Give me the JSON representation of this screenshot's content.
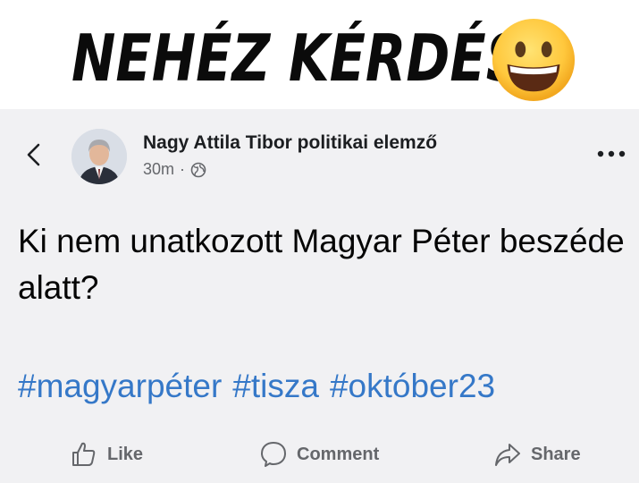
{
  "headline": {
    "title": "NEHÉZ KÉRDÉS",
    "emoji_icon": "grinning-face-emoji"
  },
  "post": {
    "author": "Nagy Attila Tibor politikai elemző",
    "time": "30m",
    "separator": "·",
    "audience_icon": "globe-icon",
    "text": "Ki nem unatkozott Magyar Péter beszéde alatt?",
    "hashtags": [
      "#magyarpéter",
      "#tisza",
      "#október23"
    ],
    "link_color": "#3578c8"
  },
  "actions": {
    "like": "Like",
    "comment": "Comment",
    "share": "Share"
  }
}
